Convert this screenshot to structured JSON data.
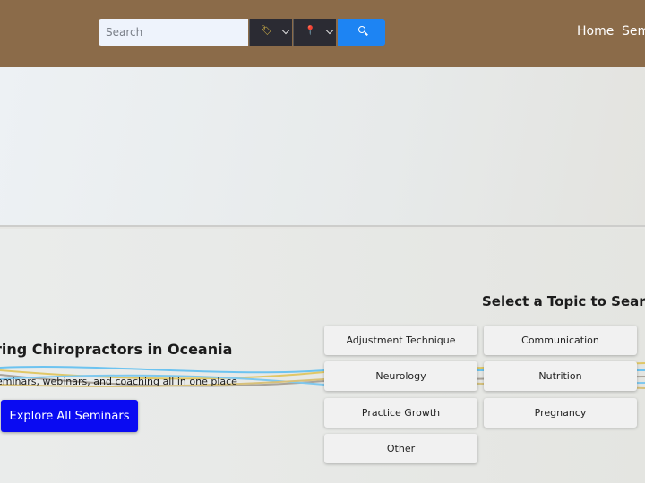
{
  "header": {
    "search": {
      "placeholder": "Search",
      "value": ""
    },
    "tag_dropdown": {
      "icon": "tag-icon",
      "glyph": "🏷"
    },
    "location_dropdown": {
      "icon": "map-pin-icon",
      "glyph": "📍"
    },
    "search_button": {
      "icon": "search-icon"
    },
    "nav": {
      "home": "Home",
      "seminars": "Sem"
    },
    "colors": {
      "bar": "#8b6b49",
      "search_button": "#1d84f3",
      "dropdown": "#2b2b33"
    }
  },
  "hero": {
    "heading": "ring Chiropractors in Oceania",
    "subtext": "eminars, webinars, and coaching all in one place",
    "cta": "Explore All Seminars",
    "cta_color": "#0a0bf2"
  },
  "topics": {
    "title": "Select a Topic to Search",
    "items": [
      "Adjustment Technique",
      "Communication",
      "Neurology",
      "Nutrition",
      "Practice Growth",
      "Pregnancy",
      "Other"
    ]
  }
}
